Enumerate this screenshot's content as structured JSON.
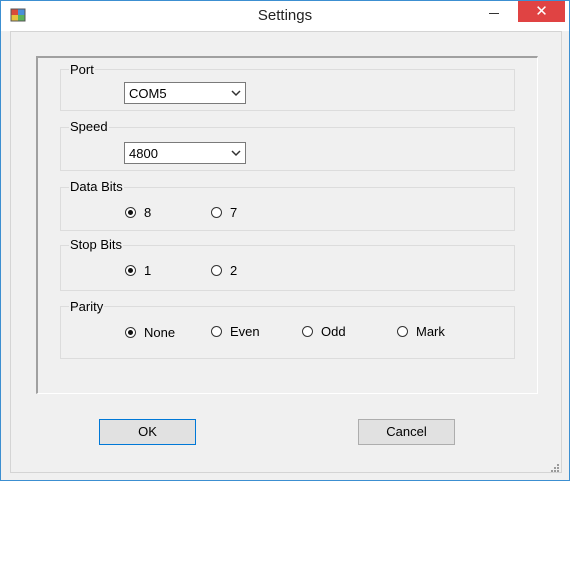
{
  "window": {
    "title": "Settings",
    "close_glyph": "✕"
  },
  "port": {
    "label": "Port",
    "value": "COM5"
  },
  "speed": {
    "label": "Speed",
    "value": "4800"
  },
  "data_bits": {
    "label": "Data Bits",
    "options": [
      "8",
      "7"
    ],
    "selected": "8"
  },
  "stop_bits": {
    "label": "Stop Bits",
    "options": [
      "1",
      "2"
    ],
    "selected": "1"
  },
  "parity": {
    "label": "Parity",
    "options": [
      "None",
      "Even",
      "Odd",
      "Mark"
    ],
    "selected": "None"
  },
  "buttons": {
    "ok": "OK",
    "cancel": "Cancel"
  },
  "colors": {
    "window_border": "#3c8fd1",
    "close_bg": "#e04343",
    "default_button_border": "#0078d7"
  },
  "icons": [
    "app-icon",
    "minimize-icon",
    "close-icon",
    "chevron-down-icon",
    "resize-grip-icon"
  ]
}
